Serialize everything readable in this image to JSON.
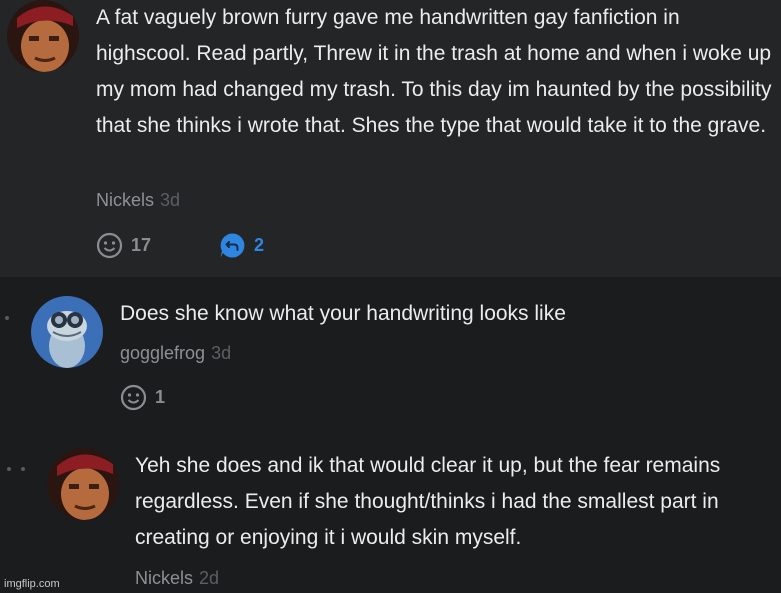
{
  "comments": [
    {
      "text": "A fat vaguely brown furry gave me handwritten gay fanfiction in highscool. Read partly, Threw it in the trash at home and when i woke up my mom had changed my trash. To this day im haunted by the possibility that she thinks i wrote that. Shes the type that would take it to the grave.",
      "author": "Nickels",
      "age": "3d",
      "likes": "17",
      "replies": "2",
      "avatar_icon": "user-avatar-red-cap"
    },
    {
      "text": "Does she know what your handwriting looks like",
      "author": "gogglefrog",
      "age": "3d",
      "likes": "1",
      "avatar_icon": "user-avatar-frog"
    },
    {
      "text": "Yeh she does and ik that would clear it up, but the fear remains regardless. Even if she thought/thinks i had the smallest part in creating or enjoying it i would skin myself.",
      "author": "Nickels",
      "age": "2d",
      "avatar_icon": "user-avatar-red-cap"
    }
  ],
  "watermark": "imgflip.com",
  "colors": {
    "background": "#1b1c1e",
    "highlight_background": "#242527",
    "reply_accent": "#2f86e0",
    "muted_text": "#8f9094"
  }
}
